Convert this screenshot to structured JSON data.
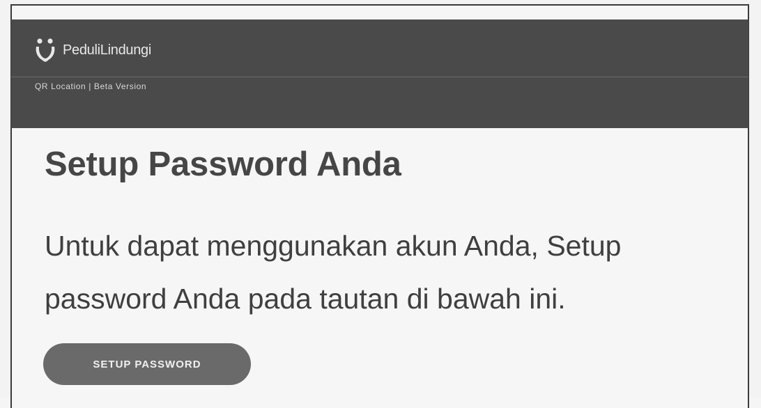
{
  "header": {
    "brand_name": "PeduliLindungi",
    "subtitle": "QR Location | Beta Version",
    "logo_icon": "pedulilindungi-logo-icon"
  },
  "main": {
    "title": "Setup Password Anda",
    "description": "Untuk dapat menggunakan akun Anda, Setup password Anda pada tautan di bawah ini.",
    "cta_label": "SETUP PASSWORD"
  },
  "colors": {
    "header_bg": "#4a4a4a",
    "button_bg": "#6a6a6a",
    "text": "#464646"
  }
}
